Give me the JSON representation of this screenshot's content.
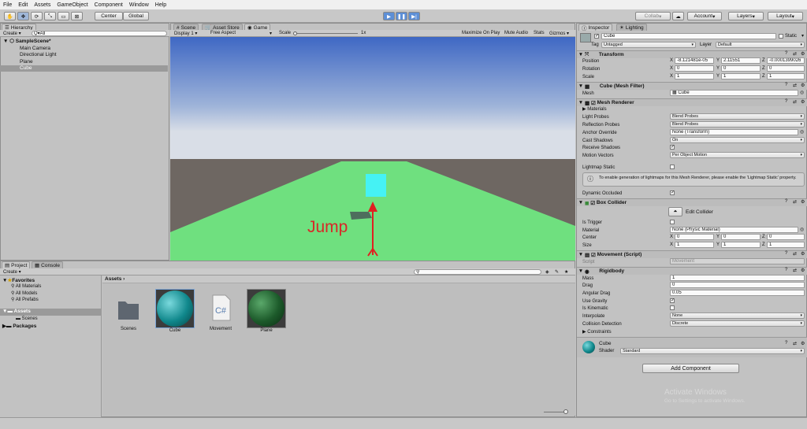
{
  "menu": [
    "File",
    "Edit",
    "Assets",
    "GameObject",
    "Component",
    "Window",
    "Help"
  ],
  "toolbar": {
    "center": "Center",
    "global": "Global",
    "collab": "Collab",
    "account": "Account",
    "layers": "Layers",
    "layout": "Layout"
  },
  "hierarchy": {
    "tab": "Hierarchy",
    "create": "Create",
    "search": "Q▾All",
    "scene": "SampleScene*",
    "items": [
      "Main Camera",
      "Directional Light",
      "Plane",
      "Cube"
    ]
  },
  "view_tabs": {
    "scene": "Scene",
    "asset_store": "Asset Store",
    "game": "Game"
  },
  "game_bar": {
    "display": "Display 1",
    "aspect": "Free Aspect",
    "scale_label": "Scale",
    "scale_value": "1x",
    "maximize": "Maximize On Play",
    "mute": "Mute Audio",
    "stats": "Stats",
    "gizmos": "Gizmos"
  },
  "game_overlay": {
    "jump": "Jump"
  },
  "project": {
    "tab": "Project",
    "console_tab": "Console",
    "create": "Create",
    "favorites": "Favorites",
    "fav_items": [
      "All Materials",
      "All Models",
      "All Prefabs"
    ],
    "assets_root": "Assets",
    "scenes": "Scenes",
    "packages": "Packages",
    "breadcrumb": "Assets",
    "assets": [
      {
        "name": "Scenes"
      },
      {
        "name": "Cube"
      },
      {
        "name": "Movement"
      },
      {
        "name": "Plane"
      }
    ]
  },
  "inspector": {
    "tab": "Inspector",
    "lighting_tab": "Lighting",
    "object_name": "Cube",
    "static": "Static",
    "tag_label": "Tag",
    "tag": "Untagged",
    "layer_label": "Layer",
    "layer": "Default",
    "transform": {
      "title": "Transform",
      "position": "Position",
      "rotation": "Rotation",
      "scale": "Scale",
      "pos": [
        "-8.121481e-05",
        "2.11551",
        "-0.0001399026"
      ],
      "rot": [
        "0",
        "0",
        "0"
      ],
      "scl": [
        "1",
        "1",
        "1"
      ]
    },
    "mesh_filter": {
      "title": "Cube (Mesh Filter)",
      "mesh_label": "Mesh",
      "mesh": "Cube"
    },
    "mesh_renderer": {
      "title": "Mesh Renderer",
      "materials": "Materials",
      "light_probes": "Light Probes",
      "light_probes_v": "Blend Probes",
      "reflection_probes": "Reflection Probes",
      "reflection_probes_v": "Blend Probes",
      "anchor": "Anchor Override",
      "anchor_v": "None (Transform)",
      "cast": "Cast Shadows",
      "cast_v": "On",
      "receive": "Receive Shadows",
      "motion": "Motion Vectors",
      "motion_v": "Per Object Motion",
      "lightmap": "Lightmap Static",
      "info": "To enable generation of lightmaps for this Mesh Renderer, please enable the 'Lightmap Static' property.",
      "occluded": "Dynamic Occluded"
    },
    "box_collider": {
      "title": "Box Collider",
      "edit": "Edit Collider",
      "trigger": "Is Trigger",
      "material": "Material",
      "material_v": "None (Physic Material)",
      "center": "Center",
      "size": "Size",
      "center_v": [
        "0",
        "0",
        "0"
      ],
      "size_v": [
        "1",
        "1",
        "1"
      ]
    },
    "movement": {
      "title": "Movement (Script)",
      "script_label": "Script",
      "script": "Movement"
    },
    "rigidbody": {
      "title": "Rigidbody",
      "mass": "Mass",
      "mass_v": "1",
      "drag": "Drag",
      "drag_v": "0",
      "angular": "Angular Drag",
      "angular_v": "0.05",
      "gravity": "Use Gravity",
      "kinematic": "Is Kinematic",
      "interpolate": "Interpolate",
      "interpolate_v": "None",
      "collision": "Collision Detection",
      "collision_v": "Discrete",
      "constraints": "Constraints"
    },
    "material": {
      "name": "Cube",
      "shader_label": "Shader",
      "shader": "Standard"
    },
    "add_component": "Add Component"
  },
  "watermark": {
    "line1": "Activate Windows",
    "line2": "Go to Settings to activate Windows."
  },
  "axes": {
    "x": "X",
    "y": "Y",
    "z": "Z"
  }
}
